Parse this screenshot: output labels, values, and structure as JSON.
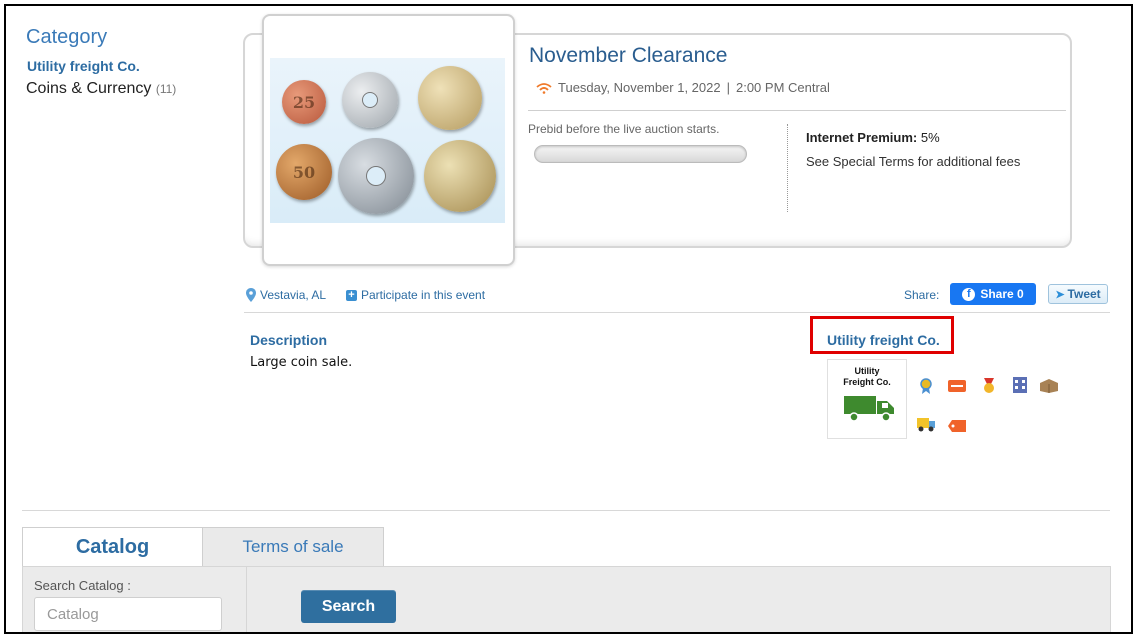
{
  "category": {
    "heading": "Category",
    "organization": "Utility freight Co.",
    "items": [
      {
        "label": "Coins & Currency",
        "count": "(11)"
      }
    ]
  },
  "event": {
    "title": "November Clearance",
    "date": "Tuesday, November 1, 2022",
    "separator": "|",
    "time": "2:00 PM Central",
    "prebid_text": "Prebid before the live auction starts.",
    "prebid_progress": 0,
    "premium_label": "Internet Premium:",
    "premium_value": "5%",
    "special_terms": "See Special Terms for additional fees",
    "photo_coins": [
      "25",
      "",
      "",
      "50",
      "",
      ""
    ]
  },
  "location": {
    "city": "Vestavia, AL",
    "participate": "Participate in this event"
  },
  "share": {
    "label": "Share:",
    "facebook": "Share 0",
    "tweet": "Tweet"
  },
  "description": {
    "heading": "Description",
    "text": "Large coin sale."
  },
  "seller": {
    "name": "Utility freight Co.",
    "logo_line1": "Utility",
    "logo_line2": "Freight Co.",
    "badges": [
      "award-ribbon-icon",
      "tag-icon",
      "medal-icon",
      "building-icon",
      "box-icon",
      "delivery-icon",
      "ticket-icon"
    ]
  },
  "tabs": {
    "catalog": "Catalog",
    "terms": "Terms of sale"
  },
  "search": {
    "label": "Search Catalog :",
    "placeholder": "Catalog",
    "button": "Search"
  },
  "colors": {
    "link_blue": "#2d6ca2",
    "highlight_red": "#e00000",
    "facebook_blue": "#1877f2",
    "search_button": "#2f6f9f"
  }
}
